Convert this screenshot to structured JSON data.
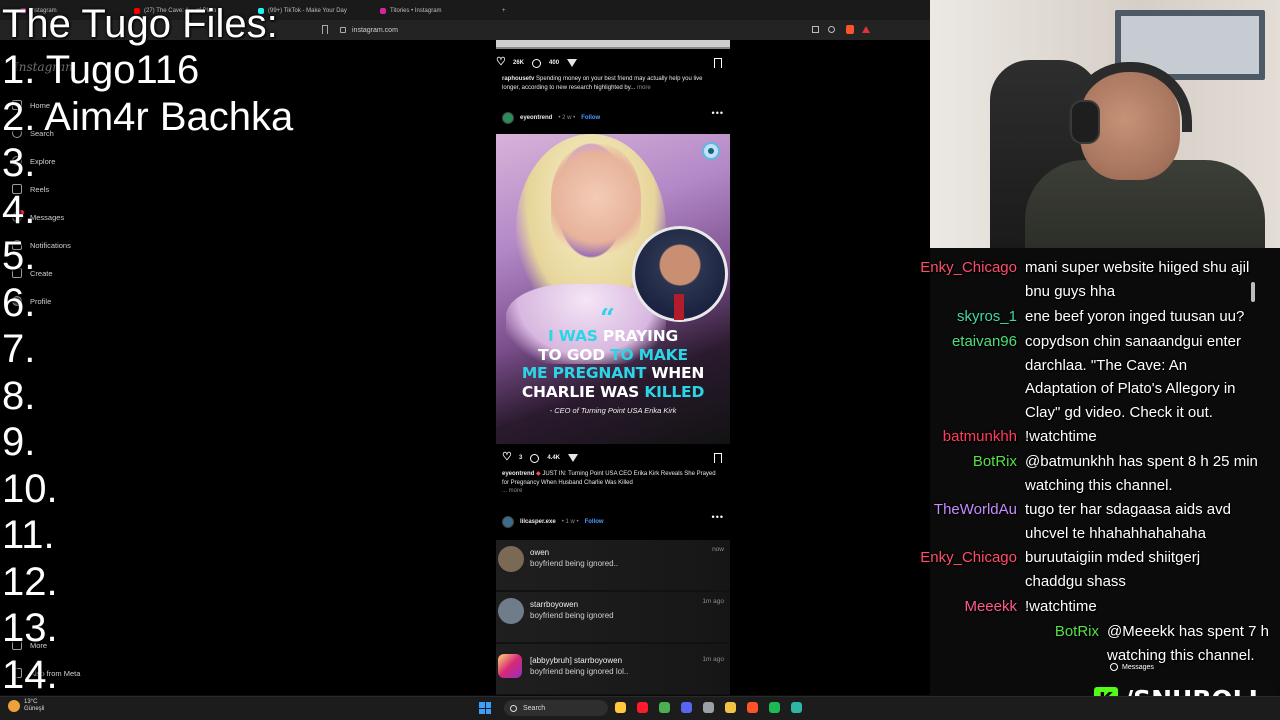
{
  "browser": {
    "tabs": [
      {
        "label": "Instagram",
        "color": "#d6249f"
      },
      {
        "label": "(27) The Cave: A... of Plato",
        "color": "#ff0000"
      },
      {
        "label": "(99+) TikTok - Make Your Day",
        "color": "#25f4ee"
      },
      {
        "label": "Titories • Instagram",
        "color": "#d6249f"
      }
    ],
    "new_tab": "+",
    "url": "instagram.com"
  },
  "sidebar": {
    "logo": "Instagram",
    "items": [
      {
        "label": "Home",
        "icon": "home-icon"
      },
      {
        "label": "Search",
        "icon": "search-icon"
      },
      {
        "label": "Explore",
        "icon": "compass-icon"
      },
      {
        "label": "Reels",
        "icon": "reels-icon"
      },
      {
        "label": "Messages",
        "icon": "messenger-icon"
      },
      {
        "label": "Notifications",
        "icon": "heart-icon"
      },
      {
        "label": "Create",
        "icon": "plus-icon"
      },
      {
        "label": "Profile",
        "icon": "avatar-icon"
      }
    ],
    "more": "More",
    "meta": "Also from Meta"
  },
  "overlay": {
    "title": "The Tugo Files:",
    "items": [
      "1. Tugo116",
      "2. Aim4r Bachka",
      "3.",
      "4.",
      "5.",
      "6.",
      "7.",
      "8.",
      "9.",
      "10.",
      "11.",
      "12.",
      "13.",
      "14."
    ]
  },
  "post1": {
    "likes": "26K",
    "comments": "400",
    "user": "raphousetv",
    "caption": "Spending money on your best friend may actually help you live longer, according to new research highlighted by...",
    "more": "more"
  },
  "post2": {
    "user": "eyeontrend",
    "age": "• 2 w •",
    "follow": "Follow",
    "headline_parts": [
      {
        "t": "I WAS ",
        "c": true
      },
      {
        "t": "PRAYING",
        "c": false
      },
      {
        "t": "\nTO GOD ",
        "c": false
      },
      {
        "t": "TO MAKE",
        "c": true
      },
      {
        "t": "\nME PREGNANT ",
        "c": true
      },
      {
        "t": "WHEN",
        "c": false
      },
      {
        "t": "\nCHARLIE WAS ",
        "c": false
      },
      {
        "t": "KILLED",
        "c": true
      }
    ],
    "attribution": "- CEO of Turning Point USA Erika Kirk",
    "likes": "3",
    "comments": "4.4K",
    "caption_user": "eyeontrend",
    "caption": "JUST IN: Turning Point USA CEO Erika Kirk Reveals She Prayed for Pregnancy When Husband Charlie Was Killed",
    "more": "... more",
    "accent": "#2ad6e6"
  },
  "post3": {
    "user": "lilcasper.exe",
    "age": "• 1 w •",
    "follow": "Follow",
    "dms": [
      {
        "name": "owen",
        "text": "boyfriend being ignored..",
        "time": "now"
      },
      {
        "name": "starrboyowen",
        "text": "boyfriend being ignored",
        "time": "1m ago"
      },
      {
        "name": "[abbyybruh] starrboyowen",
        "text": "boyfriend being ignored lol..",
        "time": "1m ago"
      }
    ]
  },
  "chat": [
    {
      "user": "Enky_Chicago",
      "color": "#ff4d6d",
      "lines": [
        "mani super website hiiged shu ajil",
        "bnu guys hha"
      ]
    },
    {
      "user": "skyros_1",
      "color": "#44d6a8",
      "lines": [
        "ene beef yoron inged tuusan uu?"
      ]
    },
    {
      "user": "etaivan96",
      "color": "#4be07a",
      "lines": [
        "copydson chin sanaandgui enter",
        "darchlaa. \"The Cave: An",
        "Adaptation of Plato's Allegory in",
        "Clay\" gd video. Check it out."
      ]
    },
    {
      "user": "batmunkhh",
      "color": "#ff3d5a",
      "lines": [
        "!watchtime"
      ]
    },
    {
      "user": "BotRix",
      "color": "#58e04b",
      "lines": [
        "@batmunkhh has spent 8 h 25 min",
        "watching this channel."
      ]
    },
    {
      "user": "TheWorldAu",
      "color": "#c58cff",
      "lines": [
        "tugo ter har sdagaasa aids avd",
        "uhcvel te hhahahhahahaha"
      ]
    },
    {
      "user": "Enky_Chicago",
      "color": "#ff4d6d",
      "lines": [
        "buruutaigiin mded shiitgerj",
        "chaddgu shass"
      ]
    },
    {
      "user": "Meeekk",
      "color": "#ff5a8a",
      "lines": [
        "!watchtime"
      ]
    },
    {
      "user": "BotRix",
      "color": "#58e04b",
      "lines": [
        "@Meeekk has spent 7 h",
        "watching this channel."
      ]
    }
  ],
  "messages_pill": "Messages",
  "taskbar": {
    "weather_temp": "13°C",
    "weather_desc": "Güneşli",
    "search": "Search",
    "apps": [
      {
        "name": "file-explorer-icon",
        "color": "#ffc83d"
      },
      {
        "name": "opera-icon",
        "color": "#ff1b2d"
      },
      {
        "name": "chrome-icon",
        "color": "#4caf50"
      },
      {
        "name": "discord-icon",
        "color": "#5865f2"
      },
      {
        "name": "settings-icon",
        "color": "#9aa0a6"
      },
      {
        "name": "folder-icon",
        "color": "#f3c244"
      },
      {
        "name": "brave-icon",
        "color": "#fb542b"
      },
      {
        "name": "spotify-icon",
        "color": "#1db954"
      },
      {
        "name": "obs-icon",
        "color": "#2fb4a6"
      }
    ]
  },
  "streamer": {
    "platform_glyph": "K",
    "handle": "/SNUBOLI"
  }
}
